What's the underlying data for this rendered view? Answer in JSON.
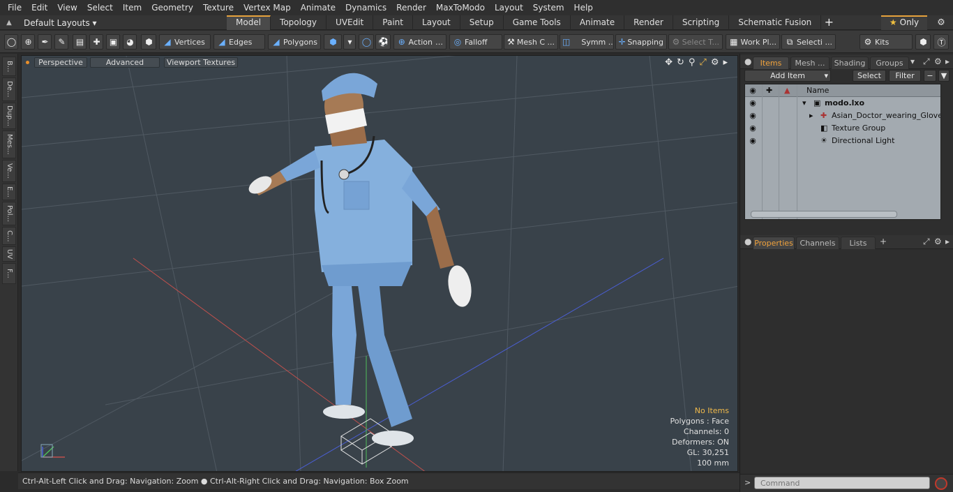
{
  "menu": [
    "File",
    "Edit",
    "View",
    "Select",
    "Item",
    "Geometry",
    "Texture",
    "Vertex Map",
    "Animate",
    "Dynamics",
    "Render",
    "MaxToModo",
    "Layout",
    "System",
    "Help"
  ],
  "layout": {
    "label": "Default Layouts ▾"
  },
  "tabs": [
    "Model",
    "Topology",
    "UVEdit",
    "Paint",
    "Layout",
    "Setup",
    "Game Tools",
    "Animate",
    "Render",
    "Scripting",
    "Schematic Fusion"
  ],
  "tab_add": "+",
  "only_label": "Only",
  "toolbar": {
    "vertices": "Vertices",
    "edges": "Edges",
    "polygons": "Polygons",
    "action": "Action",
    "falloff": "Falloff",
    "mesh": "Mesh C ...",
    "symm": "Symm ...",
    "snapping": "Snapping",
    "select_t": "Select T...",
    "work_pl": "Work Pl...",
    "selecti": "Selecti ...",
    "kits": "Kits"
  },
  "side_tabs": [
    "B...",
    "De...",
    "Dup...",
    "Mes...",
    "Ve...",
    "E...",
    "Pol...",
    "C...",
    "UV",
    "F..."
  ],
  "viewport": {
    "perspective": "Perspective",
    "advanced": "Advanced",
    "textures": "Viewport Textures",
    "stats": {
      "no_items": "No Items",
      "polygons": "Polygons : Face",
      "channels": "Channels: 0",
      "deformers": "Deformers: ON",
      "gl": "GL: 30,251",
      "size": "100 mm"
    }
  },
  "status": "Ctrl-Alt-Left Click and Drag: Navigation: Zoom ● Ctrl-Alt-Right Click and Drag: Navigation: Box Zoom",
  "items_panel": {
    "tabs": [
      "Items",
      "Mesh ...",
      "Shading",
      "Groups"
    ],
    "add_item": "Add Item",
    "select": "Select",
    "filter": "Filter",
    "name_header": "Name",
    "tree": [
      "modo.lxo",
      "Asian_Doctor_wearing_Glove...",
      "Texture Group",
      "Directional Light"
    ]
  },
  "props_panel": {
    "tabs": [
      "Properties",
      "Channels",
      "Lists"
    ],
    "add": "+"
  },
  "command": {
    "prompt": ">",
    "placeholder": "Command"
  },
  "colors": {
    "accent": "#e6a23c",
    "viewport_bg": "#39424a",
    "scrubs": "#7aa6d8"
  }
}
